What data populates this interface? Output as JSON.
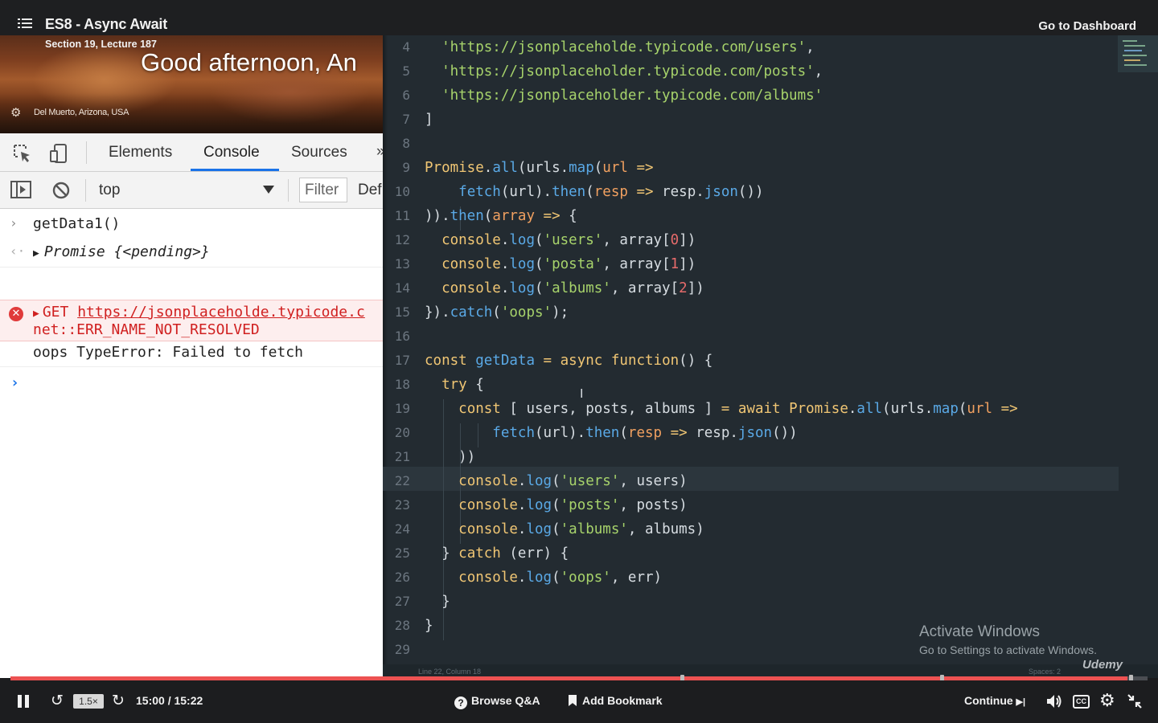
{
  "header": {
    "course_title": "ES8 - Async Await",
    "lecture": "Section 19, Lecture 187",
    "dashboard_link": "Go to Dashboard"
  },
  "browser": {
    "greeting": "Good afternoon, An",
    "location": "Del Muerto, Arizona, USA",
    "devtools": {
      "tabs": [
        "Elements",
        "Console",
        "Sources"
      ],
      "active_tab": "Console",
      "context": "top",
      "filter_placeholder": "Filter",
      "levels_label": "Def"
    },
    "console": {
      "input": "getData1()",
      "result": "Promise {<pending>}",
      "error_method": "GET",
      "error_url": "https://jsonplaceholde.typicode.c",
      "error_detail": "net::ERR_NAME_NOT_RESOLVED",
      "log": "oops TypeError: Failed to fetch"
    }
  },
  "editor": {
    "status_position": "Line 22, Column 18",
    "status_spaces": "Spaces: 2",
    "line_numbers": [
      "4",
      "5",
      "6",
      "7",
      "8",
      "9",
      "10",
      "11",
      "12",
      "13",
      "14",
      "15",
      "16",
      "17",
      "18",
      "19",
      "20",
      "21",
      "22",
      "23",
      "24",
      "25",
      "26",
      "27",
      "28",
      "29"
    ],
    "current_line": "22",
    "watermark_title": "Activate Windows",
    "watermark_sub": "Go to Settings to activate Windows.",
    "brand": "Udemy"
  },
  "player": {
    "progress_fraction": 0.982,
    "speed": "1.5×",
    "time": "15:00 / 15:22",
    "browse_qa": "Browse Q&A",
    "add_bookmark": "Add Bookmark",
    "continue": "Continue",
    "cc_label": "CC"
  },
  "colors": {
    "accent_red": "#ec5252",
    "editor_bg": "#232b31",
    "devtools_active": "#1a73e8"
  }
}
